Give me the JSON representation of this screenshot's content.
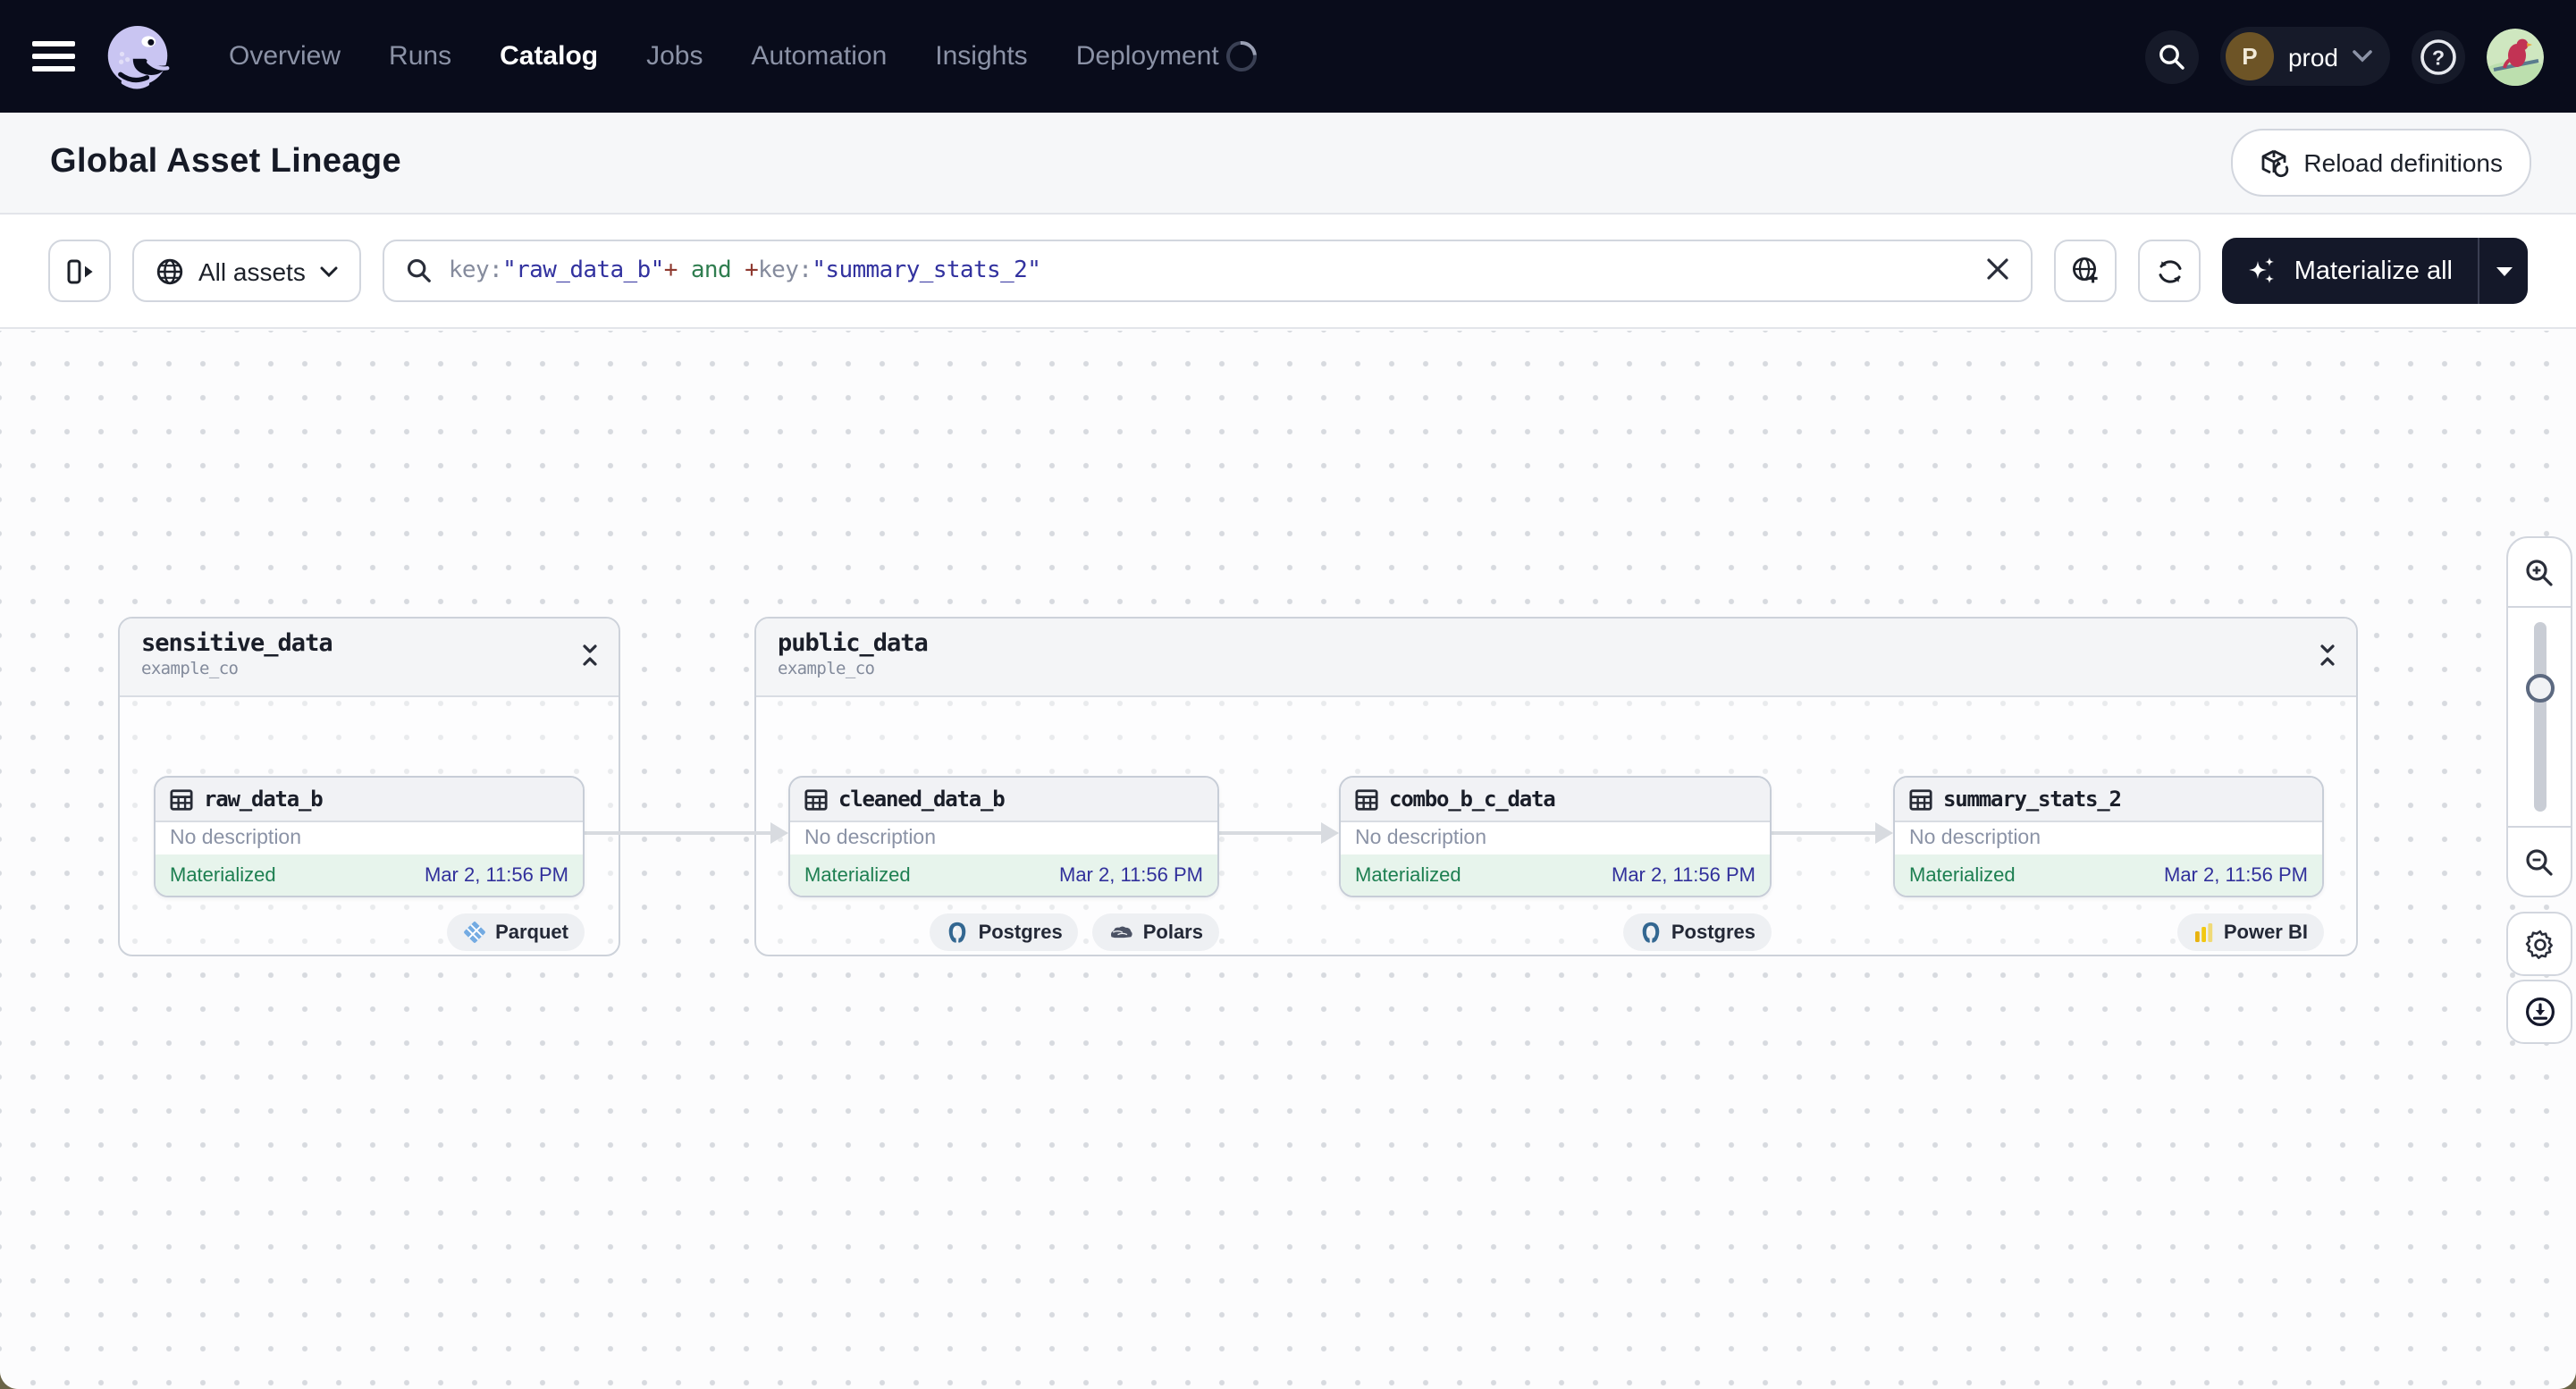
{
  "nav": {
    "items": [
      {
        "label": "Overview"
      },
      {
        "label": "Runs"
      },
      {
        "label": "Catalog"
      },
      {
        "label": "Jobs"
      },
      {
        "label": "Automation"
      },
      {
        "label": "Insights"
      },
      {
        "label": "Deployment"
      }
    ],
    "active_item": "Catalog",
    "deployment_pill": {
      "initial": "P",
      "label": "prod"
    }
  },
  "page_header": {
    "title": "Global Asset Lineage",
    "reload_label": "Reload definitions"
  },
  "toolbar": {
    "scope": {
      "label": "All assets"
    },
    "search": {
      "parts": [
        {
          "text": "key:",
          "style": "field"
        },
        {
          "text": "\"raw_data_b\"",
          "style": "value"
        },
        {
          "text": "+",
          "style": "operator"
        },
        {
          "text": " and ",
          "style": "keyword"
        },
        {
          "text": "+",
          "style": "operator"
        },
        {
          "text": "key:",
          "style": "field"
        },
        {
          "text": "\"summary_stats_2\"",
          "style": "value"
        }
      ]
    },
    "materialize_label": "Materialize all"
  },
  "graph": {
    "groups": [
      {
        "name": "sensitive_data",
        "location": "example_co"
      },
      {
        "name": "public_data",
        "location": "example_co"
      }
    ],
    "nodes": [
      {
        "name": "raw_data_b",
        "description": "No description",
        "status": "Materialized",
        "timestamp": "Mar 2, 11:56 PM",
        "tags": [
          "Parquet"
        ]
      },
      {
        "name": "cleaned_data_b",
        "description": "No description",
        "status": "Materialized",
        "timestamp": "Mar 2, 11:56 PM",
        "tags": [
          "Postgres",
          "Polars"
        ]
      },
      {
        "name": "combo_b_c_data",
        "description": "No description",
        "status": "Materialized",
        "timestamp": "Mar 2, 11:56 PM",
        "tags": [
          "Postgres"
        ]
      },
      {
        "name": "summary_stats_2",
        "description": "No description",
        "status": "Materialized",
        "timestamp": "Mar 2, 11:56 PM",
        "tags": [
          "Power BI"
        ]
      }
    ]
  },
  "icons": {
    "menu": "hamburger",
    "logo": "dagster-octopus",
    "search": "magnifier",
    "help": "question-mark-circle",
    "reload": "cube-refresh",
    "scope": "globe",
    "clear": "x",
    "zoom_to_fit": "globe-plus",
    "refresh": "sync-arrows",
    "materialize": "sparkles",
    "asset": "table-grid",
    "collapse": "unfold-less",
    "zoom_in": "magnifier-plus",
    "zoom_out": "magnifier-minus",
    "settings": "gear",
    "export": "download-circle"
  },
  "colors": {
    "nav_bg": "#090c1b",
    "status_green": "#1d7f51",
    "status_green_bg": "#e7f4ec",
    "timestamp_indigo": "#31309b",
    "query_value": "#32329f",
    "query_operator": "#8f3a30",
    "query_keyword": "#2f7d4f",
    "materialize_bg": "#141829",
    "desktop_corner": "#6b6548"
  }
}
